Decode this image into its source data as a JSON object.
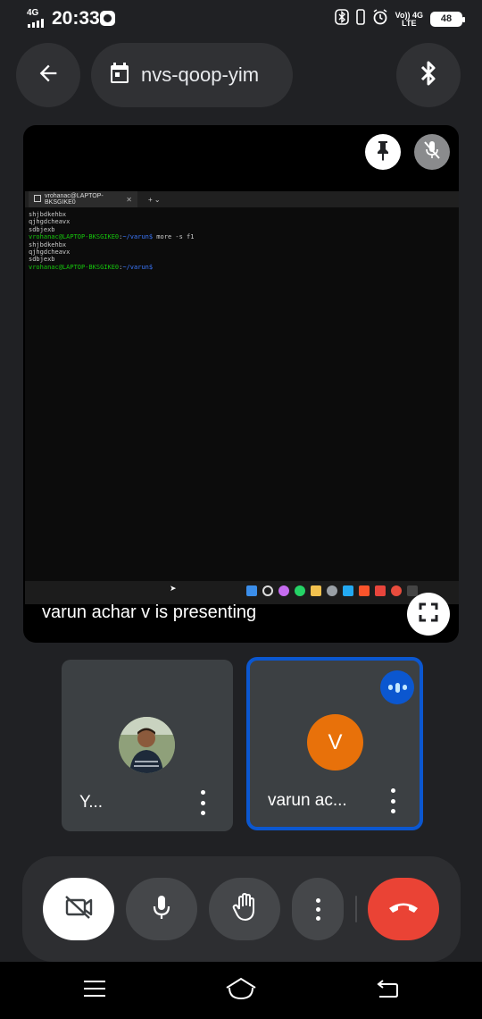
{
  "status_bar": {
    "network_type": "4G",
    "time": "20:33",
    "volte_label": "Vo)) 4G",
    "lte_label": "LTE",
    "battery_level": "48"
  },
  "header": {
    "meeting_code": "nvs-qoop-yim"
  },
  "presentation": {
    "label": "varun achar v is presenting",
    "terminal": {
      "tab_title": "vrohanac@LAPTOP-BKSGIKE0",
      "lines": [
        {
          "text": "shjbdkehbx",
          "style": "normal"
        },
        {
          "text": "qjhgdcheavx",
          "style": "normal"
        },
        {
          "text": "sdbjexb",
          "style": "normal"
        },
        {
          "text": "vrohanac@LAPTOP-BKSGIKE0:~/varun$ more -s f1",
          "style": "prompt"
        },
        {
          "text": "shjbdkehbx",
          "style": "normal"
        },
        {
          "text": "qjhgdcheavx",
          "style": "normal"
        },
        {
          "text": "sdbjexb",
          "style": "normal"
        },
        {
          "text": "vrohanac@LAPTOP-BKSGIKE0:~/varun$",
          "style": "prompt"
        }
      ]
    }
  },
  "participants": [
    {
      "name": "Y...",
      "avatar": "photo",
      "speaking": false
    },
    {
      "name": "varun ac...",
      "avatar_letter": "V",
      "avatar_color": "#e8710a",
      "speaking": true
    }
  ],
  "controls": {
    "camera": "camera-off-icon",
    "mic": "mic-icon",
    "raise_hand": "hand-icon",
    "more": "more-vert-icon",
    "end_call": "call-end-icon"
  },
  "colors": {
    "background": "#202124",
    "surface": "#303134",
    "accent_blue": "#0b57d0",
    "end_call_red": "#ea4335",
    "avatar_orange": "#e8710a"
  }
}
